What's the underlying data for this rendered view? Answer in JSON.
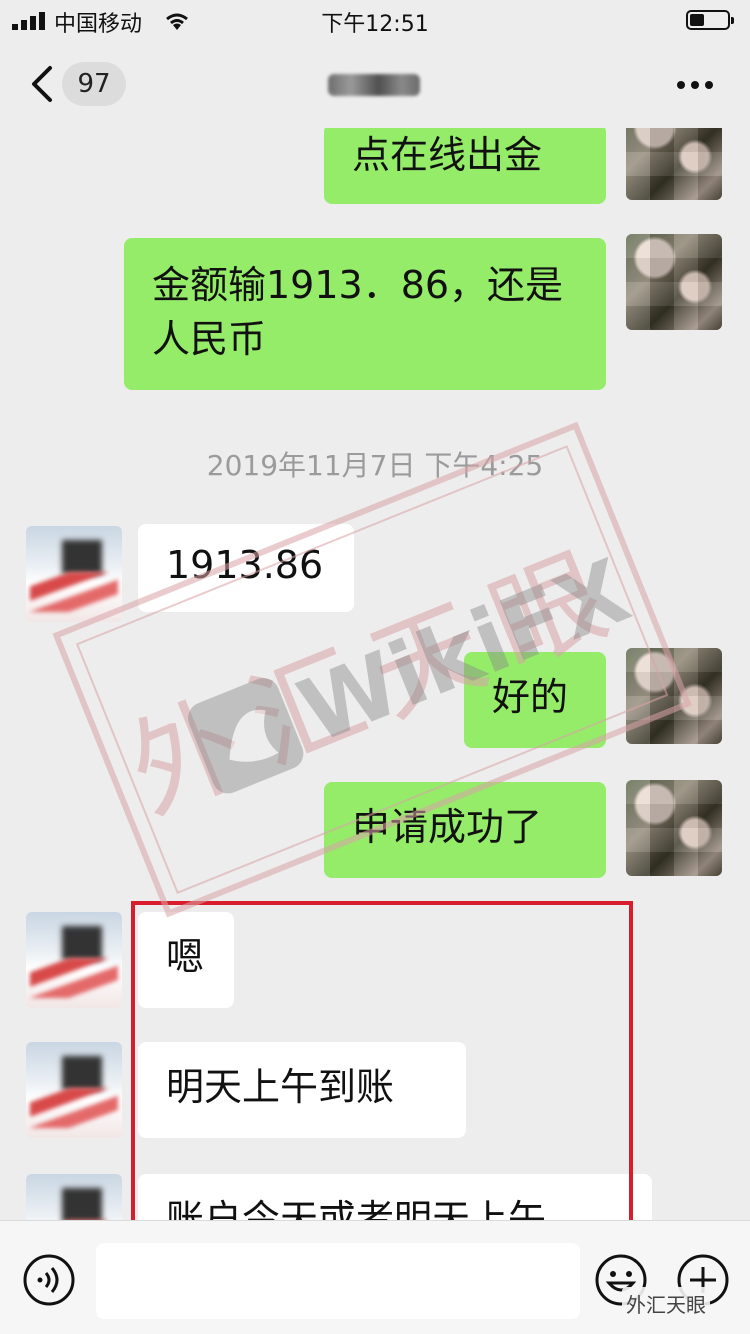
{
  "status_bar": {
    "carrier": "中国移动",
    "time": "下午12:51"
  },
  "nav": {
    "unread_count": "97"
  },
  "messages": [
    {
      "side": "out",
      "text": "点在线出金"
    },
    {
      "side": "out",
      "text": "金额输1913．86，还是人民币"
    },
    {
      "side": "in",
      "text": "1913.86"
    },
    {
      "side": "out",
      "text": "好的"
    },
    {
      "side": "out",
      "text": "申请成功了"
    },
    {
      "side": "in",
      "text": "嗯"
    },
    {
      "side": "in",
      "text": "明天上午到账"
    },
    {
      "side": "in",
      "text": "账户今天或者明天上午"
    }
  ],
  "timestamp": "2019年11月7日 下午4:25",
  "watermark": {
    "brand": "WikiFX",
    "stamp_text": "外汇天眼",
    "stamp_color": "#d9a3a8"
  },
  "footer_brand": "外汇天眼",
  "colors": {
    "outgoing_bubble": "#95ec69",
    "incoming_bubble": "#ffffff",
    "highlight_border": "#d81e2c",
    "background": "#ededed"
  },
  "icons": {
    "back": "chevron-left-icon",
    "more": "more-icon",
    "voice": "voice-icon",
    "emoji": "emoji-icon",
    "plus": "plus-icon"
  }
}
